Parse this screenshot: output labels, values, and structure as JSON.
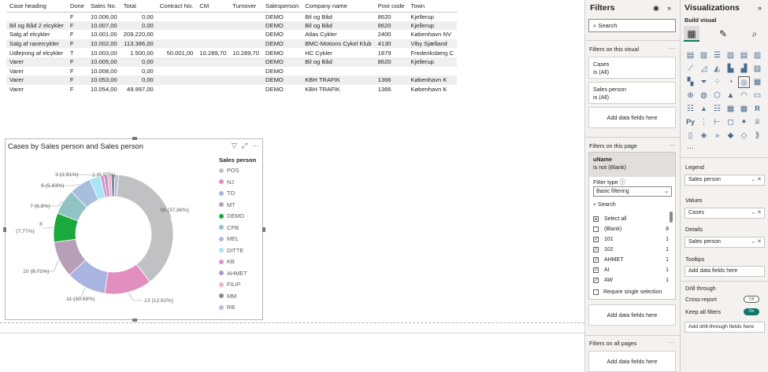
{
  "table": {
    "columns": [
      "Case heading",
      "Done",
      "Sales No.",
      "Total",
      "Contract No.",
      "CM",
      "Turnover",
      "Salesperson",
      "Company name",
      "Post code",
      "Town"
    ],
    "rows": [
      [
        "",
        "F",
        "10.006,00",
        "0,00",
        "",
        "",
        "",
        "DEMO",
        "Bil og Båd",
        "8620",
        "Kjellerup"
      ],
      [
        "Bil og Båd 2 elcykler",
        "F",
        "10.007,00",
        "0,00",
        "",
        "",
        "",
        "DEMO",
        "Bil og Båd",
        "8620",
        "Kjellerup"
      ],
      [
        "Salg af elcykler",
        "F",
        "10.001,00",
        "209.220,00",
        "",
        "",
        "",
        "DEMO",
        "Atlas Cykler",
        "2400",
        "København NV"
      ],
      [
        "Salg af racercykler",
        "F",
        "10.002,00",
        "113.386,00",
        "",
        "",
        "",
        "DEMO",
        "BMC-Motions Cykel Klub",
        "4130",
        "Viby Sjælland"
      ],
      [
        "Udlejning af elcykler",
        "T",
        "10.003,00",
        "1.500,00",
        "50.001,00",
        "10.289,70",
        "10.289,70",
        "DEMO",
        "HC Cykler",
        "1879",
        "Frederiksberg C"
      ],
      [
        "Varer",
        "F",
        "10.005,00",
        "0,00",
        "",
        "",
        "",
        "DEMO",
        "Bil og Båd",
        "8620",
        "Kjellerup"
      ],
      [
        "Varer",
        "F",
        "10.008,00",
        "0,00",
        "",
        "",
        "",
        "DEMO",
        "",
        "",
        ""
      ],
      [
        "Varer",
        "F",
        "10.053,00",
        "0,00",
        "",
        "",
        "",
        "DEMO",
        "KBH TRAFIK",
        "1366",
        "København K"
      ],
      [
        "Varer",
        "F",
        "10.054,00",
        "49.997,00",
        "",
        "",
        "",
        "DEMO",
        "KBH TRAFIK",
        "1366",
        "København K"
      ]
    ]
  },
  "donut": {
    "title": "Cases by Sales person and Sales person",
    "legend_title": "Sales person"
  },
  "chart_data": {
    "type": "pie",
    "title": "Cases by Sales person and Sales person",
    "legend_title": "Sales person",
    "legend_position": "right",
    "donut": true,
    "categories": [
      "POS",
      "NJ",
      "TO",
      "MT",
      "DEMO",
      "CPB",
      "MEL",
      "DITTE",
      "KB",
      "AHMET",
      "FILIP",
      "MM",
      "RB"
    ],
    "values": [
      39,
      13,
      11,
      10,
      8,
      7,
      6,
      3,
      1,
      1,
      1,
      1,
      1
    ],
    "colors": [
      "#c1c1c3",
      "#e28fbf",
      "#aab4e0",
      "#b79fb8",
      "#1aaa3b",
      "#8fc3c4",
      "#a7bedc",
      "#a7e6f4",
      "#e48ec6",
      "#b097c8",
      "#f0b3cd",
      "#7f8c9c",
      "#b2bfdd"
    ],
    "data_labels": [
      "39 (37,86%)",
      "13 (12,62%)",
      "11 (10,68%)",
      "10 (9,71%)",
      "8 (7,77%)",
      "7 (6,8%)",
      "6 (5,83%)",
      "3 (2,91%)",
      "1 (0,97%)",
      "",
      "",
      "",
      ""
    ]
  },
  "filters": {
    "title": "Filters",
    "search_placeholder": "Search",
    "on_visual_label": "Filters on this visual",
    "cases_name": "Cases",
    "cases_value": "is (All)",
    "salesperson_name": "Sales person",
    "salesperson_value": "is (All)",
    "add_fields": "Add data fields here",
    "on_page_label": "Filters on this page",
    "uname_name": "uName",
    "uname_value": "is not (Blank)",
    "filter_type_label": "Filter type",
    "filter_type_value": "Basic filtering",
    "inner_search": "Search",
    "items": [
      {
        "label": "Select all",
        "count": "",
        "checked": "partial"
      },
      {
        "label": "(Blank)",
        "count": "8",
        "checked": false
      },
      {
        "label": "101",
        "count": "1",
        "checked": true
      },
      {
        "label": "102",
        "count": "1",
        "checked": true
      },
      {
        "label": "AHMET",
        "count": "1",
        "checked": true
      },
      {
        "label": "AI",
        "count": "1",
        "checked": true
      },
      {
        "label": "AW",
        "count": "1",
        "checked": true
      }
    ],
    "require_single": "Require single selection",
    "on_all_pages_label": "Filters on all pages"
  },
  "viz": {
    "title": "Visualizations",
    "build_label": "Build visual",
    "legend_label": "Legend",
    "legend_field": "Sales person",
    "values_label": "Values",
    "values_field": "Cases",
    "details_label": "Details",
    "details_field": "Sales person",
    "tooltips_label": "Tooltips",
    "tooltips_add": "Add data fields here",
    "drill_label": "Drill through",
    "cross_report": "Cross-report",
    "cross_report_state": "Off",
    "keep_filters": "Keep all filters",
    "keep_filters_state": "On",
    "drill_add": "Add drill-through fields here",
    "icons": [
      "stacked-bar",
      "stacked-column",
      "clustered-bar",
      "clustered-column",
      "100-bar",
      "100-column",
      "line",
      "area",
      "stacked-area",
      "line-column",
      "line-clustered",
      "ribbon",
      "waterfall",
      "funnel",
      "scatter",
      "pie",
      "donut",
      "treemap",
      "map",
      "filled-map",
      "shape-map",
      "azure-map",
      "gauge",
      "card",
      "multi-card",
      "kpi",
      "slicer",
      "table",
      "matrix",
      "r-visual",
      "python",
      "key-influencers",
      "decomposition-tree",
      "qa",
      "smart-narrative",
      "metrics",
      "paginated",
      "power-apps",
      "power-automate",
      "arcgis",
      "more-a",
      "more-b"
    ]
  }
}
